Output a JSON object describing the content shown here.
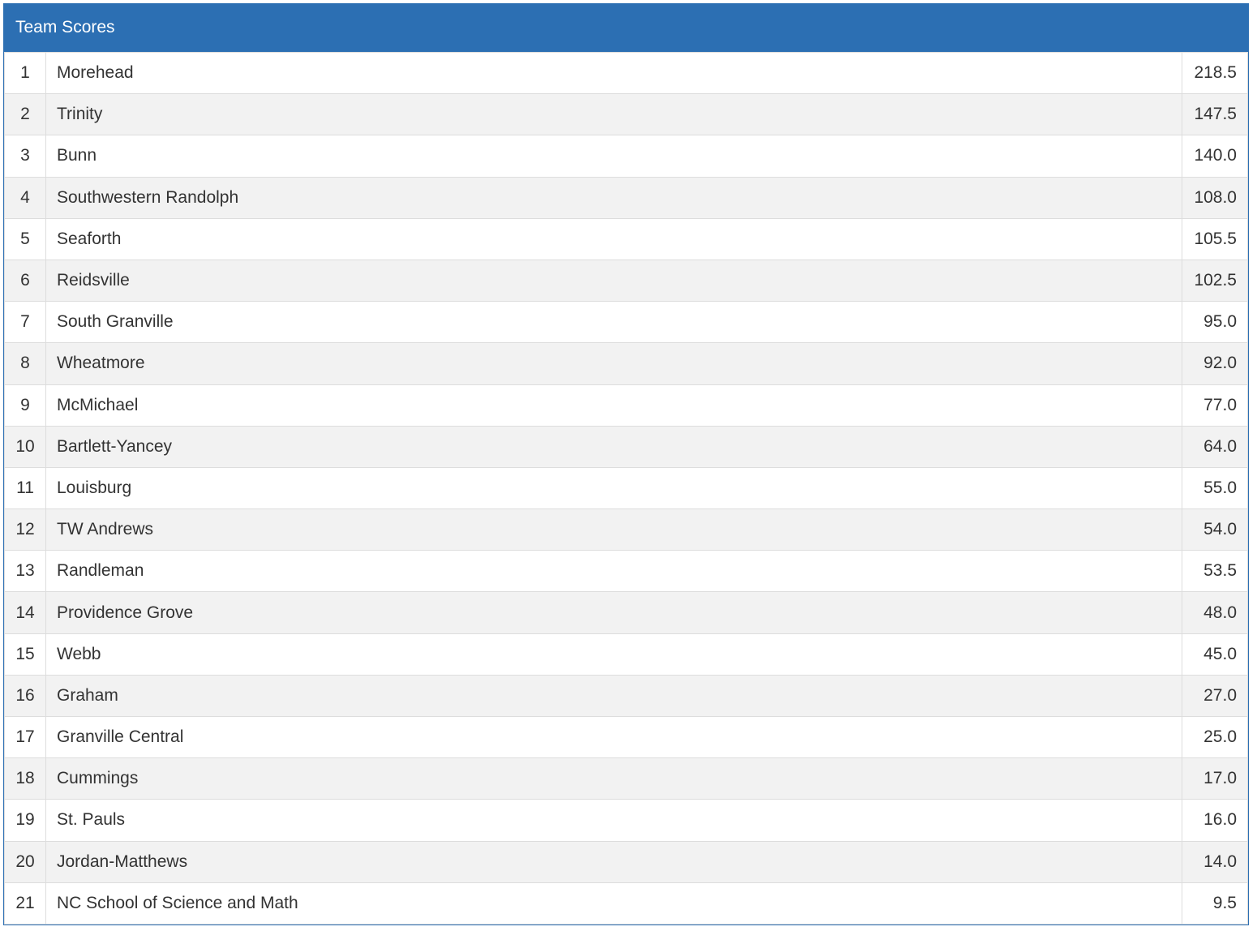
{
  "panel": {
    "title": "Team Scores",
    "header_color": "#2c6fb3"
  },
  "rows": [
    {
      "place": "1",
      "team": "Morehead",
      "score": "218.5"
    },
    {
      "place": "2",
      "team": "Trinity",
      "score": "147.5"
    },
    {
      "place": "3",
      "team": "Bunn",
      "score": "140.0"
    },
    {
      "place": "4",
      "team": "Southwestern Randolph",
      "score": "108.0"
    },
    {
      "place": "5",
      "team": "Seaforth",
      "score": "105.5"
    },
    {
      "place": "6",
      "team": "Reidsville",
      "score": "102.5"
    },
    {
      "place": "7",
      "team": "South Granville",
      "score": "95.0"
    },
    {
      "place": "8",
      "team": "Wheatmore",
      "score": "92.0"
    },
    {
      "place": "9",
      "team": "McMichael",
      "score": "77.0"
    },
    {
      "place": "10",
      "team": "Bartlett-Yancey",
      "score": "64.0"
    },
    {
      "place": "11",
      "team": "Louisburg",
      "score": "55.0"
    },
    {
      "place": "12",
      "team": "TW Andrews",
      "score": "54.0"
    },
    {
      "place": "13",
      "team": "Randleman",
      "score": "53.5"
    },
    {
      "place": "14",
      "team": "Providence Grove",
      "score": "48.0"
    },
    {
      "place": "15",
      "team": "Webb",
      "score": "45.0"
    },
    {
      "place": "16",
      "team": "Graham",
      "score": "27.0"
    },
    {
      "place": "17",
      "team": "Granville Central",
      "score": "25.0"
    },
    {
      "place": "18",
      "team": "Cummings",
      "score": "17.0"
    },
    {
      "place": "19",
      "team": "St. Pauls",
      "score": "16.0"
    },
    {
      "place": "20",
      "team": "Jordan-Matthews",
      "score": "14.0"
    },
    {
      "place": "21",
      "team": "NC School of Science and Math",
      "score": "9.5"
    }
  ]
}
